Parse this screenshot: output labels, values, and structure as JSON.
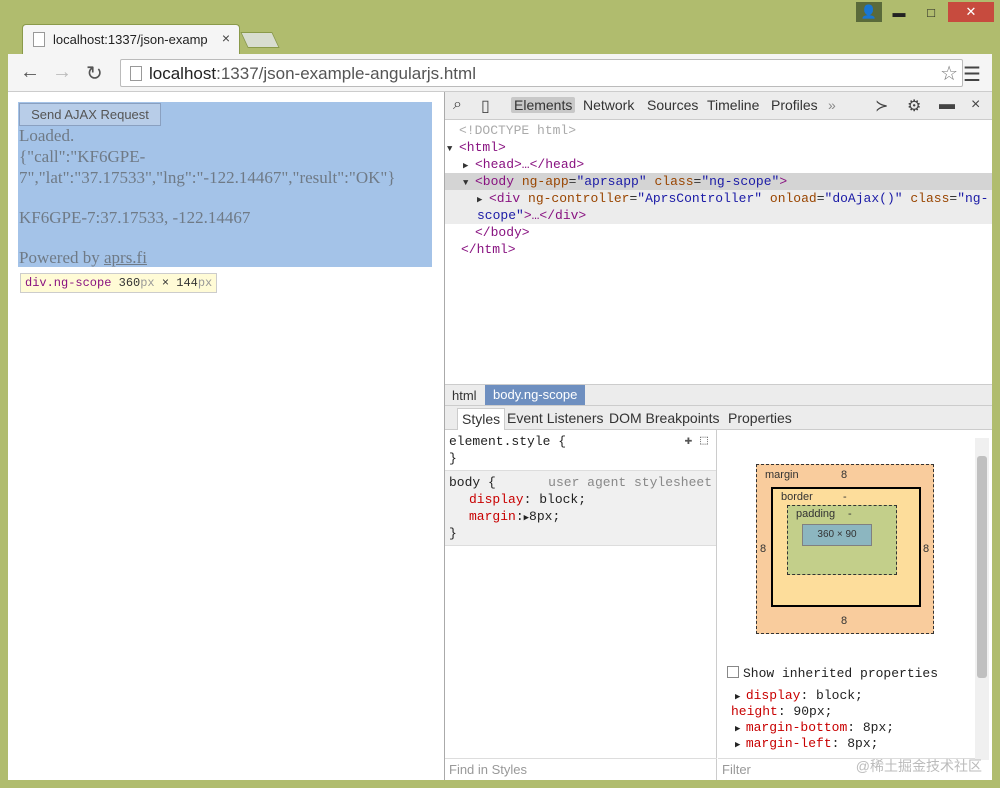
{
  "window": {
    "tab_title": "localhost:1337/json-examp",
    "tab_close": "×",
    "btn_min": "▬",
    "btn_max": "□",
    "btn_close": "✕",
    "btn_user": "👤"
  },
  "toolbar": {
    "back": "←",
    "forward": "→",
    "reload": "↻",
    "url_host": "localhost",
    "url_rest": ":1337/json-example-angularjs.html",
    "star": "☆",
    "menu": "☰"
  },
  "page": {
    "button_label": "Send AJAX Request",
    "loaded": "Loaded.",
    "json_line1": "{\"call\":\"KF6GPE-",
    "json_line2": "7\",\"lat\":\"37.17533\",\"lng\":\"-122.14467\",\"result\":\"OK\"}",
    "coords": "KF6GPE-7:37.17533, -122.14467",
    "powered_prefix": "Powered by ",
    "powered_link": "aprs.fi",
    "tooltip_tag": "div.ng-scope",
    "tooltip_w": "360",
    "tooltip_px1": "px",
    "tooltip_x": " × ",
    "tooltip_h": "144",
    "tooltip_px2": "px"
  },
  "devtools": {
    "tabs": [
      "Elements",
      "Network",
      "Sources",
      "Timeline",
      "Profiles",
      "»"
    ],
    "dom": {
      "doctype": "<!DOCTYPE html>",
      "html_open": "<html>",
      "head": "<head>…</head>",
      "body_tag": "<body",
      "body_attr1": "ng-app",
      "body_val1": "\"aprsapp\"",
      "body_attr2": "class",
      "body_val2": "\"ng-scope\"",
      "div_tag": "<div",
      "div_attr1": "ng-controller",
      "div_val1": "\"AprsController\"",
      "div_attr2": "onload",
      "div_val2": "\"doAjax()\"",
      "div_attr3": "class",
      "div_val3": "\"ng-",
      "div_val3b": "scope\"",
      "div_close": ">…</div>",
      "body_close": "</body>",
      "html_close": "</html>"
    },
    "breadcrumbs": [
      "html",
      "body.ng-scope"
    ],
    "style_tabs": [
      "Styles",
      "Event Listeners",
      "DOM Breakpoints",
      "Properties"
    ],
    "element_style": "element.style {",
    "element_style_close": "}",
    "body_rule": "body {",
    "ua_source": "user agent stylesheet",
    "prop_display": "display",
    "val_display": "block;",
    "prop_margin": "margin",
    "val_margin": "8px;",
    "rule_close": "}",
    "find_placeholder": "Find in Styles",
    "box": {
      "margin_label": "margin",
      "margin_top": "8",
      "margin_bottom": "8",
      "margin_left": "8",
      "margin_right": "8",
      "border_label": "border",
      "border_val": "-",
      "padding_label": "padding",
      "padding_val": "-",
      "content": "360 × 90",
      "dash": "-"
    },
    "show_inherited": "Show inherited properties",
    "computed": [
      {
        "name": "display",
        "value": "block;",
        "arrow": true
      },
      {
        "name": "height",
        "value": "90px;",
        "arrow": false
      },
      {
        "name": "margin-bottom",
        "value": "8px;",
        "arrow": true
      },
      {
        "name": "margin-left",
        "value": "8px;",
        "arrow": true
      }
    ],
    "filter_placeholder": "Filter",
    "watermark": "@稀土掘金技术社区"
  }
}
